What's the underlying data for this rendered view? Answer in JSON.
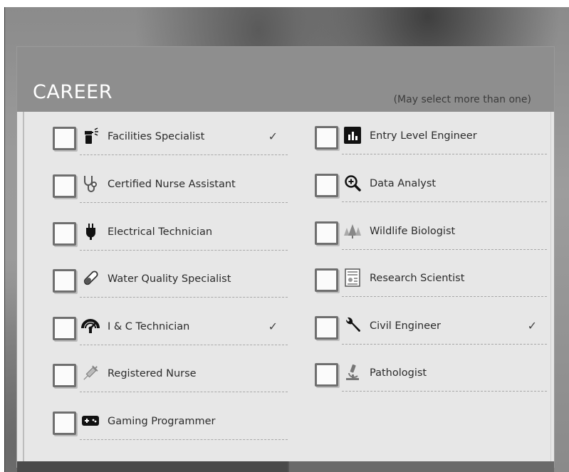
{
  "panel": {
    "title": "CAREER",
    "hint": "(May select more than one)"
  },
  "careers_left": [
    {
      "label": "Facilities Specialist",
      "icon": "spray-bottle-icon",
      "checked_mark": "✓"
    },
    {
      "label": "Certified Nurse Assistant",
      "icon": "stethoscope-icon",
      "checked_mark": ""
    },
    {
      "label": "Electrical Technician",
      "icon": "plug-icon",
      "checked_mark": ""
    },
    {
      "label": "Water Quality Specialist",
      "icon": "test-tube-icon",
      "checked_mark": ""
    },
    {
      "label": "I & C Technician",
      "icon": "gauge-icon",
      "checked_mark": "✓"
    },
    {
      "label": "Registered Nurse",
      "icon": "syringe-icon",
      "checked_mark": ""
    },
    {
      "label": "Gaming Programmer",
      "icon": "gamepad-icon",
      "checked_mark": ""
    }
  ],
  "careers_right": [
    {
      "label": "Entry Level Engineer",
      "icon": "bar-chart-icon",
      "checked_mark": ""
    },
    {
      "label": "Data Analyst",
      "icon": "magnifier-plus-icon",
      "checked_mark": ""
    },
    {
      "label": "Wildlife Biologist",
      "icon": "trees-icon",
      "checked_mark": ""
    },
    {
      "label": "Research Scientist",
      "icon": "document-icon",
      "checked_mark": ""
    },
    {
      "label": "Civil Engineer",
      "icon": "wrench-icon",
      "checked_mark": "✓"
    },
    {
      "label": "Pathologist",
      "icon": "microscope-icon",
      "checked_mark": ""
    }
  ]
}
